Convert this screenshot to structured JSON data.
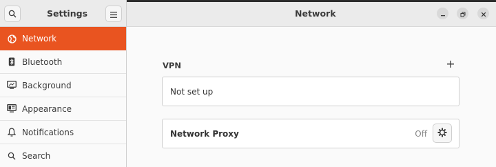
{
  "header": {
    "sidebar_title": "Settings",
    "window_title": "Network"
  },
  "sidebar": {
    "items": [
      {
        "label": "Network",
        "icon": "network-globe-icon",
        "active": true
      },
      {
        "label": "Bluetooth",
        "icon": "bluetooth-icon",
        "active": false
      },
      {
        "label": "Background",
        "icon": "background-icon",
        "active": false
      },
      {
        "label": "Appearance",
        "icon": "appearance-icon",
        "active": false
      },
      {
        "label": "Notifications",
        "icon": "bell-icon",
        "active": false
      },
      {
        "label": "Search",
        "icon": "search-icon",
        "active": false
      }
    ]
  },
  "vpn": {
    "title": "VPN",
    "add_symbol": "+",
    "empty_text": "Not set up"
  },
  "proxy": {
    "label": "Network Proxy",
    "status": "Off"
  },
  "colors": {
    "accent": "#e95420",
    "header_bg": "#ebebeb",
    "content_bg": "#fafafa"
  }
}
